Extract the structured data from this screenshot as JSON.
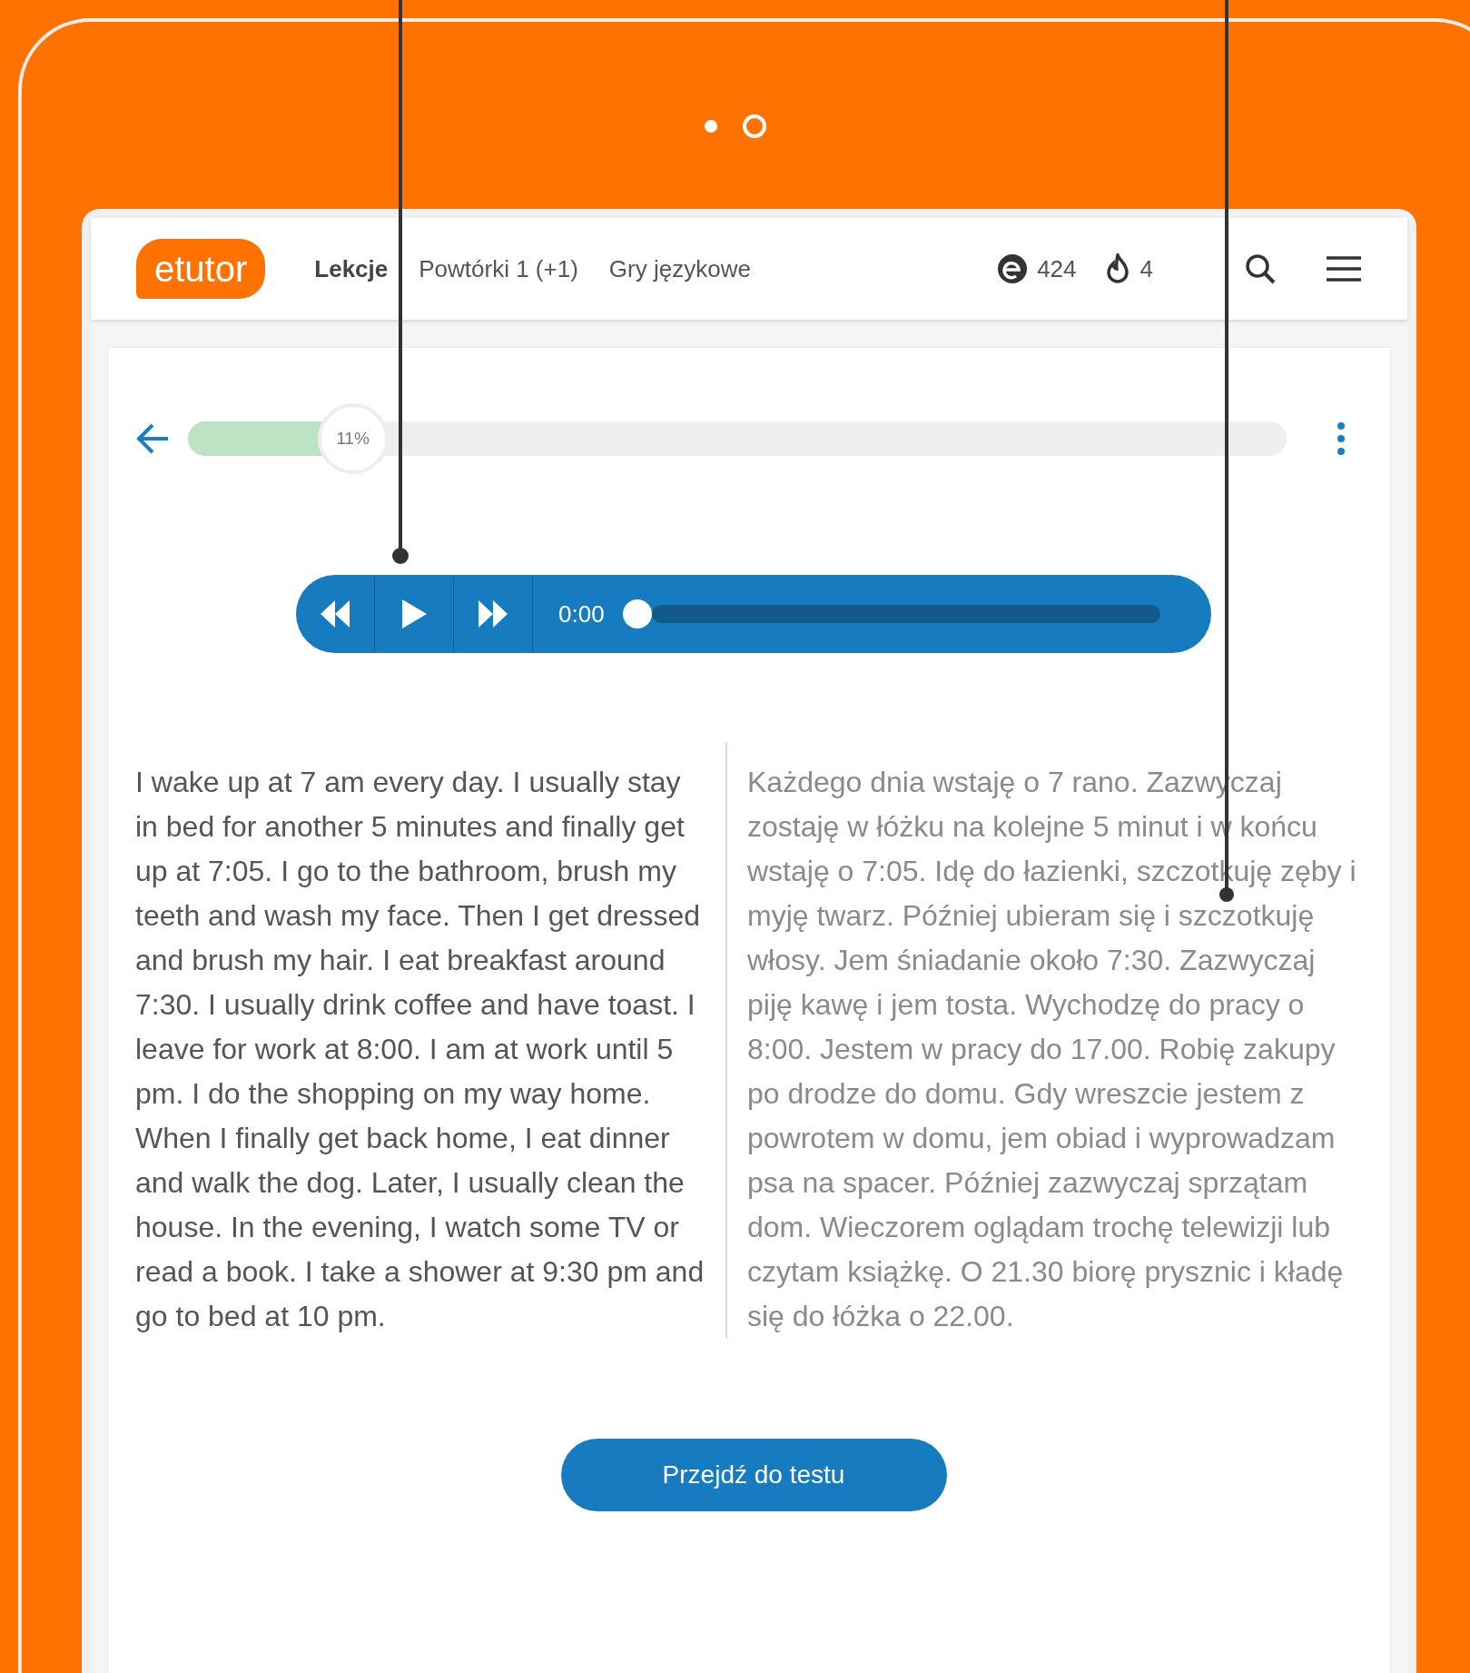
{
  "header": {
    "logo": "etutor",
    "nav": [
      {
        "label": "Lekcje",
        "selected": true
      },
      {
        "label": "Powtórki 1 (+1)",
        "selected": false
      },
      {
        "label": "Gry językowe",
        "selected": false
      }
    ],
    "points": "424",
    "streak": "4"
  },
  "progress": {
    "level": 0.11,
    "label": "11%"
  },
  "player": {
    "time": "0:00",
    "level": 0
  },
  "texts": {
    "original": "I wake up at 7 am every day. I usually stay in bed for another 5 minutes and finally get up at 7:05. I go to the bathroom, brush my teeth and wash my face. Then I get dressed and brush my hair. I eat breakfast around 7:30. I usually drink coffee and have toast. I leave for work at 8:00. I am at work until 5 pm. I do the shopping on my way home. When I finally get back home, I eat dinner and walk the dog. Later, I usually clean the house. In the evening, I watch some TV or read a book. I take a shower at 9:30 pm and go to bed at 10 pm.",
    "translation": "Każdego dnia wstaję o 7 rano. Zazwyczaj zostaję w łóżku na kolejne 5 minut i w końcu wstaję o 7:05. Idę do łazienki, szczotkuję zęby i myję twarz. Później ubieram się i szczotkuję włosy. Jem śniadanie około 7:30. Zazwyczaj piję kawę i jem tosta. Wychodzę do pracy o 8:00. Jestem w pracy do 17.00. Robię zakupy po drodze do domu. Gdy wreszcie jestem z powrotem w domu, jem obiad i wyprowadzam psa na spacer. Później zazwyczaj sprzątam dom. Wieczorem oglądam trochę telewizji lub czytam książkę. O 21.30 biorę prysznic i kładę się do łóżka o 22.00."
  },
  "button": "Przejdź do testu"
}
